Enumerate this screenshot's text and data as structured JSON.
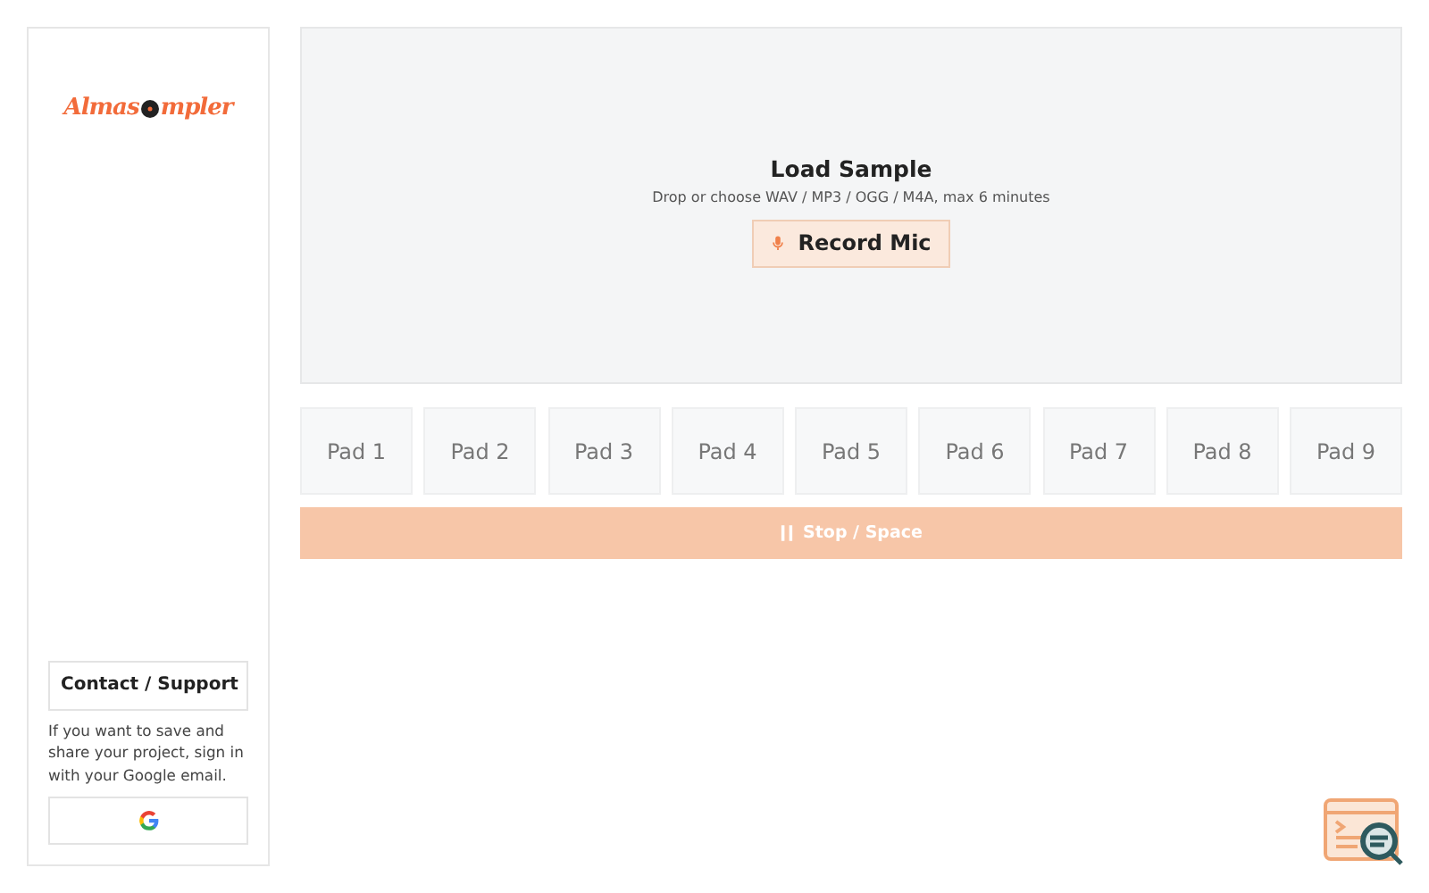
{
  "sidebar": {
    "logo": {
      "before": "Almas",
      "after": "mpler"
    },
    "contact_button": "Contact / Support",
    "note": "If you want to save and share your project, sign in with your Google email."
  },
  "drop_zone": {
    "title": "Load Sample",
    "hint": "Drop or choose WAV / MP3 / OGG / M4A, max 6 minutes",
    "record_button": "Record Mic"
  },
  "pads": [
    {
      "label": "Pad 1"
    },
    {
      "label": "Pad 2"
    },
    {
      "label": "Pad 3"
    },
    {
      "label": "Pad 4"
    },
    {
      "label": "Pad 5"
    },
    {
      "label": "Pad 6"
    },
    {
      "label": "Pad 7"
    },
    {
      "label": "Pad 8"
    },
    {
      "label": "Pad 9"
    }
  ],
  "stop_button": "Stop / Space"
}
